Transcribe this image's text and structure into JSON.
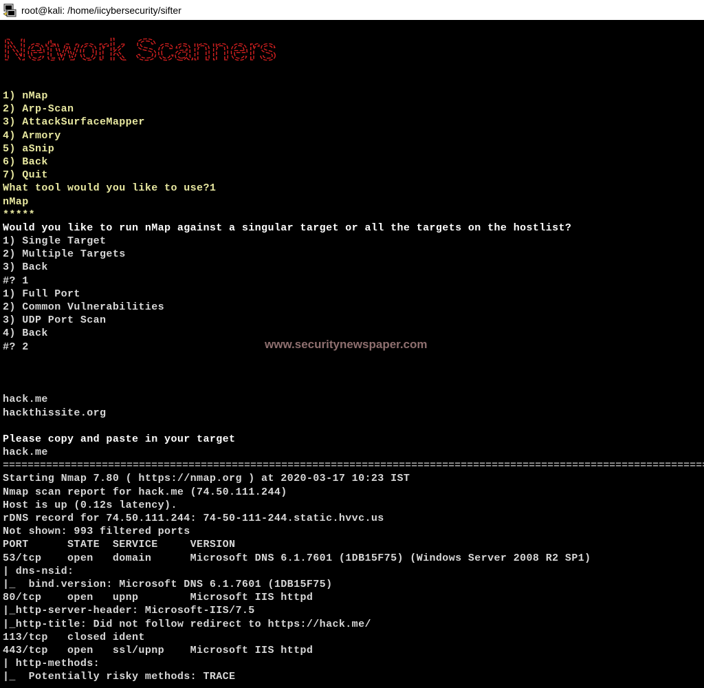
{
  "window": {
    "title": "root@kali: /home/iicybersecurity/sifter"
  },
  "banner": {
    "text": "Network Scanners",
    "color": "#d42020"
  },
  "watermark": "www.securitynewspaper.com",
  "terminal": {
    "lines": [
      {
        "text": "1) nMap",
        "color": "yellow"
      },
      {
        "text": "2) Arp-Scan",
        "color": "yellow"
      },
      {
        "text": "3) AttackSurfaceMapper",
        "color": "yellow"
      },
      {
        "text": "4) Armory",
        "color": "yellow"
      },
      {
        "text": "5) aSnip",
        "color": "yellow"
      },
      {
        "text": "6) Back",
        "color": "yellow"
      },
      {
        "text": "7) Quit",
        "color": "yellow"
      },
      {
        "text": "What tool would you like to use?1",
        "color": "yellow"
      },
      {
        "text": "nMap",
        "color": "yellow"
      },
      {
        "text": "*****",
        "color": "yellow"
      },
      {
        "text": "Would you like to run nMap against a singular target or all the targets on the hostlist?",
        "color": "white"
      },
      {
        "text": "1) Single Target",
        "color": "gray"
      },
      {
        "text": "2) Multiple Targets",
        "color": "gray"
      },
      {
        "text": "3) Back",
        "color": "gray"
      },
      {
        "text": "#? 1",
        "color": "gray"
      },
      {
        "text": "1) Full Port",
        "color": "gray"
      },
      {
        "text": "2) Common Vulnerabilities",
        "color": "gray"
      },
      {
        "text": "3) UDP Port Scan",
        "color": "gray"
      },
      {
        "text": "4) Back",
        "color": "gray"
      },
      {
        "text": "#? 2",
        "color": "gray"
      },
      {
        "text": "",
        "color": "gray"
      },
      {
        "text": "",
        "color": "gray"
      },
      {
        "text": "",
        "color": "gray"
      },
      {
        "text": "hack.me",
        "color": "gray"
      },
      {
        "text": "hackthissite.org",
        "color": "gray"
      },
      {
        "text": "",
        "color": "gray"
      },
      {
        "text": "Please copy and paste in your target",
        "color": "white"
      },
      {
        "text": "hack.me",
        "color": "gray"
      },
      {
        "text": "=====================================================================================================================",
        "color": "rule"
      },
      {
        "text": "Starting Nmap 7.80 ( https://nmap.org ) at 2020-03-17 10:23 IST",
        "color": "gray"
      },
      {
        "text": "Nmap scan report for hack.me (74.50.111.244)",
        "color": "gray"
      },
      {
        "text": "Host is up (0.12s latency).",
        "color": "gray"
      },
      {
        "text": "rDNS record for 74.50.111.244: 74-50-111-244.static.hvvc.us",
        "color": "gray"
      },
      {
        "text": "Not shown: 993 filtered ports",
        "color": "gray"
      },
      {
        "text": "PORT      STATE  SERVICE     VERSION",
        "color": "gray"
      },
      {
        "text": "53/tcp    open   domain      Microsoft DNS 6.1.7601 (1DB15F75) (Windows Server 2008 R2 SP1)",
        "color": "gray"
      },
      {
        "text": "| dns-nsid:",
        "color": "gray"
      },
      {
        "text": "|_  bind.version: Microsoft DNS 6.1.7601 (1DB15F75)",
        "color": "gray"
      },
      {
        "text": "80/tcp    open   upnp        Microsoft IIS httpd",
        "color": "gray"
      },
      {
        "text": "|_http-server-header: Microsoft-IIS/7.5",
        "color": "gray"
      },
      {
        "text": "|_http-title: Did not follow redirect to https://hack.me/",
        "color": "gray"
      },
      {
        "text": "113/tcp   closed ident",
        "color": "gray"
      },
      {
        "text": "443/tcp   open   ssl/upnp    Microsoft IIS httpd",
        "color": "gray"
      },
      {
        "text": "| http-methods:",
        "color": "gray"
      },
      {
        "text": "|_  Potentially risky methods: TRACE",
        "color": "gray"
      }
    ]
  }
}
